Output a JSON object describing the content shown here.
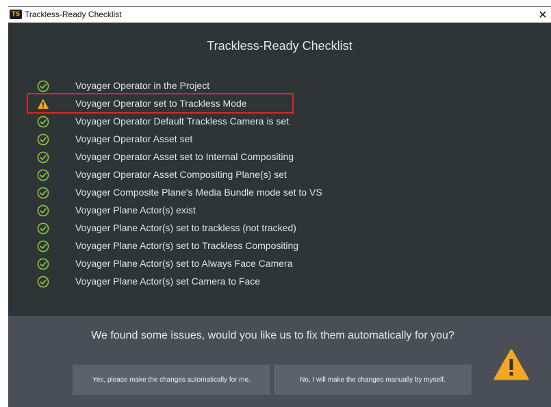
{
  "window": {
    "title": "Trackless-Ready Checklist",
    "app_icon_text": "TS",
    "close_glyph": "✕"
  },
  "heading": "Trackless-Ready Checklist",
  "checklist": [
    {
      "label": "Voyager Operator in the Project",
      "status": "ok",
      "icon": "check-circle-icon"
    },
    {
      "label": "Voyager Operator set to Trackless Mode",
      "status": "warning",
      "icon": "warning-icon"
    },
    {
      "label": "Voyager Operator Default Trackless Camera is set",
      "status": "ok",
      "icon": "check-circle-icon"
    },
    {
      "label": "Voyager Operator Asset set",
      "status": "ok",
      "icon": "check-circle-icon"
    },
    {
      "label": "Voyager Operator Asset set to Internal Compositing",
      "status": "ok",
      "icon": "check-circle-icon"
    },
    {
      "label": "Voyager Operator Asset Compositing Plane(s) set",
      "status": "ok",
      "icon": "check-circle-icon"
    },
    {
      "label": "Voyager Composite Plane's Media Bundle mode set to VS",
      "status": "ok",
      "icon": "check-circle-icon"
    },
    {
      "label": "Voyager Plane Actor(s) exist",
      "status": "ok",
      "icon": "check-circle-icon"
    },
    {
      "label": "Voyager Plane Actor(s) set to trackless (not tracked)",
      "status": "ok",
      "icon": "check-circle-icon"
    },
    {
      "label": "Voyager Plane Actor(s) set to Trackless Compositing",
      "status": "ok",
      "icon": "check-circle-icon"
    },
    {
      "label": "Voyager Plane Actor(s) set to Always Face Camera",
      "status": "ok",
      "icon": "check-circle-icon"
    },
    {
      "label": "Voyager Plane Actor(s) set Camera to Face",
      "status": "ok",
      "icon": "check-circle-icon"
    }
  ],
  "footer": {
    "question": "We found some issues, would you like us to fix them automatically for you?",
    "auto_button_label": "Yes, please make the changes automatically for me.",
    "manual_button_label": "No, I will make the changes manually by myself.",
    "warning_icon": "warning-icon"
  },
  "colors": {
    "background": "#2f3436",
    "footer": "#4a4f57",
    "button": "#5c626b",
    "ok_green": "#8cc63f",
    "warning_orange": "#f5a623",
    "highlight_red": "#d42a2a"
  }
}
